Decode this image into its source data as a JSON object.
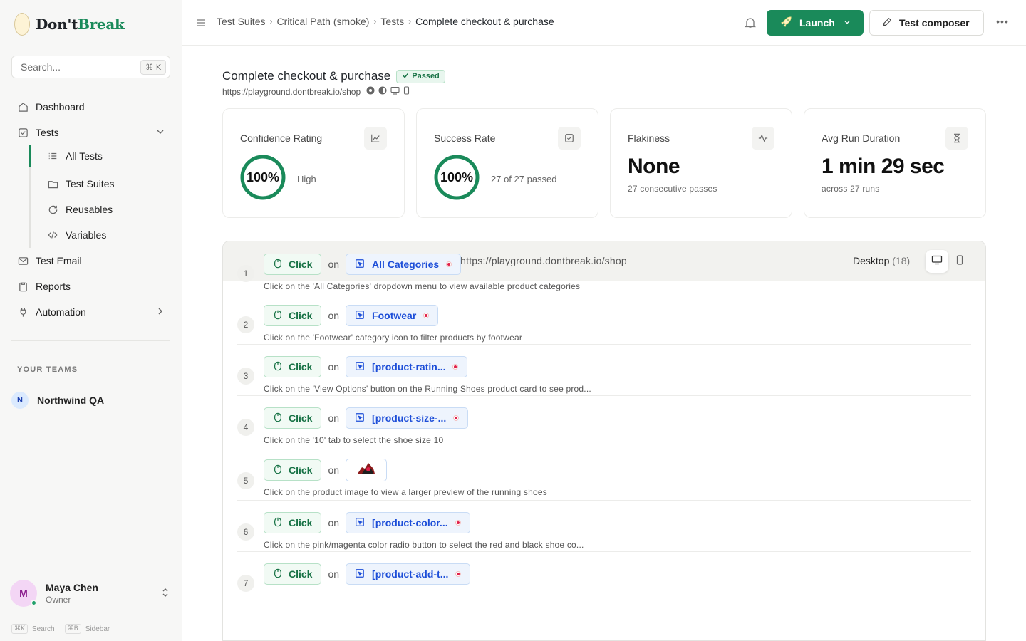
{
  "brand": {
    "name_main": "Don't",
    "name_accent": "Break"
  },
  "search": {
    "placeholder": "Search...",
    "shortcut": "⌘ K"
  },
  "nav": {
    "dashboard": "Dashboard",
    "tests": "Tests",
    "tests_sub": [
      "All Tests",
      "Test Suites",
      "Reusables",
      "Variables"
    ],
    "test_email": "Test Email",
    "reports": "Reports",
    "automation": "Automation"
  },
  "teams": {
    "label": "YOUR TEAMS",
    "items": [
      {
        "initial": "N",
        "name": "Northwind QA"
      }
    ]
  },
  "user": {
    "initial": "M",
    "name": "Maya Chen",
    "role": "Owner"
  },
  "shortcuts": [
    {
      "key": "⌘K",
      "label": "Search"
    },
    {
      "key": "⌘B",
      "label": "Sidebar"
    }
  ],
  "breadcrumb": [
    "Test Suites",
    "Critical Path (smoke)",
    "Tests",
    "Complete checkout & purchase"
  ],
  "toolbar": {
    "launch": "Launch",
    "composer": "Test composer"
  },
  "test": {
    "title": "Complete checkout & purchase",
    "status": "Passed",
    "url": "https://playground.dontbreak.io/shop"
  },
  "metrics": [
    {
      "title": "Confidence Rating",
      "value": "100%",
      "sub": "High",
      "percent": 100
    },
    {
      "title": "Success Rate",
      "value": "100%",
      "sub": "27 of 27 passed",
      "percent": 100
    },
    {
      "title": "Flakiness",
      "value": "None",
      "sub": "27 consecutive passes"
    },
    {
      "title": "Avg Run Duration",
      "value": "1 min 29 sec",
      "sub": "across 27 runs"
    }
  ],
  "steps_panel": {
    "url": "https://playground.dontbreak.io/shop",
    "device": "Desktop",
    "device_count": "(18)",
    "on_label": "on"
  },
  "steps": [
    {
      "num": "1",
      "action": "Click",
      "target": "All Categories",
      "desc": "Click on the 'All Categories' dropdown menu to view available product categories"
    },
    {
      "num": "2",
      "action": "Click",
      "target": "Footwear",
      "desc": "Click on the 'Footwear' category icon to filter products by footwear"
    },
    {
      "num": "3",
      "action": "Click",
      "target": "[product-ratin...",
      "desc": "Click on the 'View Options' button on the Running Shoes product card to see prod..."
    },
    {
      "num": "4",
      "action": "Click",
      "target": "[product-size-...",
      "desc": "Click on the '10' tab to select the shoe size 10"
    },
    {
      "num": "5",
      "action": "Click",
      "target": "",
      "desc": "Click on the product image to view a larger preview of the running shoes"
    },
    {
      "num": "6",
      "action": "Click",
      "target": "[product-color...",
      "desc": "Click on the pink/magenta color radio button to select the red and black shoe co..."
    },
    {
      "num": "7",
      "action": "Click",
      "target": "[product-add-t...",
      "desc": ""
    }
  ],
  "colors": {
    "accent": "#1a8a5a",
    "target_blue": "#1d4ed8",
    "ring": "#1a8a5a"
  }
}
